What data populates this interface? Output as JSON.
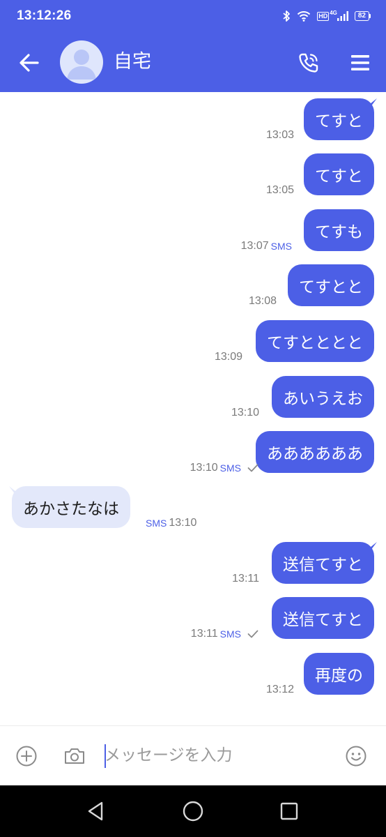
{
  "status_bar": {
    "time": "13:12:26",
    "network_label": "HD",
    "network_type": "4G",
    "battery_level": "82"
  },
  "header": {
    "contact_name": "自宅",
    "back_icon": "arrow-left-icon",
    "call_icon": "phone-call-icon",
    "menu_icon": "hamburger-menu-icon"
  },
  "messages": [
    {
      "direction": "out",
      "text": "てすと",
      "time": "13:03",
      "sms": "",
      "delivered": false
    },
    {
      "direction": "out",
      "text": "てすと",
      "time": "13:05",
      "sms": "",
      "delivered": false
    },
    {
      "direction": "out",
      "text": "てすも",
      "time": "13:07",
      "sms": "SMS",
      "delivered": false
    },
    {
      "direction": "out",
      "text": "てすとと",
      "time": "13:08",
      "sms": "",
      "delivered": false
    },
    {
      "direction": "out",
      "text": "てすとととと",
      "time": "13:09",
      "sms": "",
      "delivered": false
    },
    {
      "direction": "out",
      "text": "あいうえお",
      "time": "13:10",
      "sms": "",
      "delivered": false
    },
    {
      "direction": "out",
      "text": "ああああああ",
      "time": "13:10",
      "sms": "SMS",
      "delivered": true
    },
    {
      "direction": "in",
      "text": "あかさたなは",
      "time": "13:10",
      "sms": "SMS",
      "delivered": false
    },
    {
      "direction": "out",
      "text": "送信てすと",
      "time": "13:11",
      "sms": "",
      "delivered": false
    },
    {
      "direction": "out",
      "text": "送信てすと",
      "time": "13:11",
      "sms": "SMS",
      "delivered": true
    },
    {
      "direction": "out",
      "text": "再度の",
      "time": "13:12",
      "sms": "",
      "delivered": false
    }
  ],
  "composer": {
    "placeholder": "メッセージを入力",
    "value": "",
    "attach_icon": "plus-circle-icon",
    "camera_icon": "camera-icon",
    "emoji_icon": "smiley-face-icon"
  },
  "nav_bar": {
    "back_icon": "triangle-back-icon",
    "home_icon": "circle-home-icon",
    "recents_icon": "square-recents-icon"
  },
  "colors": {
    "accent": "#4c5fe6",
    "incoming_bubble": "#e3e8fa",
    "timestamp": "#7a7a7a"
  }
}
